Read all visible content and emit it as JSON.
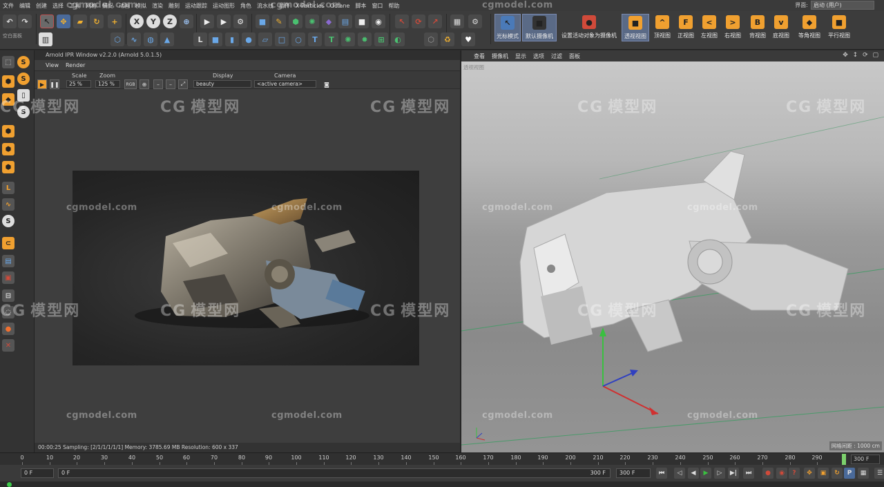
{
  "menubar": {
    "items": [
      "文件",
      "编辑",
      "创建",
      "选择",
      "工具",
      "网格",
      "捕捉",
      "动画",
      "模拟",
      "渲染",
      "雕刻",
      "运动跟踪",
      "运动图形",
      "角色",
      "流水线",
      "插件",
      "X-Particles",
      "Octane",
      "脚本",
      "窗口",
      "帮助"
    ],
    "layout_label": "界面:",
    "layout_value": "启动 (用户)"
  },
  "toolbar": {
    "left_top": "空白面板",
    "icons": [
      "undo-icon",
      "select-arrow-icon",
      "move-icon",
      "scale-icon",
      "rotate-icon",
      "x-axis-icon",
      "y-axis-icon",
      "z-axis-icon",
      "world-coords-icon",
      "render-view-icon",
      "render-picture-queue-icon",
      "render-settings-icon",
      "cube-icon",
      "pen-icon",
      "subdivision-icon",
      "cloner-icon",
      "deformer-icon",
      "floor-icon",
      "camera-icon",
      "light-icon"
    ],
    "axis_labels": {
      "x": "X",
      "y": "Y",
      "z": "Z"
    },
    "view_buttons": [
      {
        "label": "光标模式",
        "glyph": "↖",
        "color": "#4a7ab8",
        "selected": true
      },
      {
        "label": "默认摄像机",
        "glyph": "■",
        "color": "#333333",
        "selected": true
      },
      {
        "label": "设置活动对象为摄像机",
        "glyph": "●",
        "color": "#d04a3a",
        "selected": false
      },
      {
        "label": "透视视图",
        "glyph": "■",
        "color": "#f0a030",
        "selected": true
      },
      {
        "label": "顶视图",
        "glyph": "^",
        "color": "#f0a030",
        "selected": false
      },
      {
        "label": "正视图",
        "glyph": "F",
        "color": "#f0a030",
        "selected": false
      },
      {
        "label": "左视图",
        "glyph": "<",
        "color": "#f0a030",
        "selected": false
      },
      {
        "label": "右视图",
        "glyph": ">",
        "color": "#f0a030",
        "selected": false
      },
      {
        "label": "背视图",
        "glyph": "B",
        "color": "#f0a030",
        "selected": false
      },
      {
        "label": "底视图",
        "glyph": "v",
        "color": "#f0a030",
        "selected": false
      },
      {
        "label": "等角视图",
        "glyph": "◆",
        "color": "#f0a030",
        "selected": false
      },
      {
        "label": "平行视图",
        "glyph": "■",
        "color": "#f0a030",
        "selected": false
      }
    ]
  },
  "ipr": {
    "title": "Arnold IPR Window v2.2.0 (Arnold 5.0.1.5)",
    "menu": [
      "View",
      "Render"
    ],
    "scale_label": "Scale",
    "scale_value": "25 %",
    "zoom_label": "Zoom",
    "zoom_value": "125 %",
    "rgb_label": "RGB",
    "display_label": "Display",
    "display_value": "beauty",
    "camera_label": "Camera",
    "camera_value": "<active camera>",
    "status": "00:00:25  Sampling: [2/1/1/1/1/1]  Memory: 3785.69 MB  Resolution: 600 x 337"
  },
  "viewport": {
    "menu": [
      "查看",
      "摄像机",
      "显示",
      "选项",
      "过滤",
      "面板"
    ],
    "view_label": "透视视图",
    "nav_icons": "✥ ↕ ⟳ ▢",
    "grid_label": "网格间距 : 1000 cm"
  },
  "watermarks": {
    "url": "cgmodel.com",
    "logo": "模型网",
    "logo_prefix": "CG"
  },
  "timeline": {
    "ticks": [
      "0",
      "10",
      "20",
      "30",
      "40",
      "50",
      "60",
      "70",
      "80",
      "90",
      "100",
      "110",
      "120",
      "130",
      "140",
      "150",
      "160",
      "170",
      "180",
      "190",
      "200",
      "210",
      "220",
      "230",
      "240",
      "250",
      "260",
      "270",
      "280",
      "290"
    ],
    "end_frame": "300 F"
  },
  "transport": {
    "current_frame": "0 F",
    "range_start": "0 F",
    "range_end": "300 F",
    "max_frame": "300 F",
    "buttons": [
      "go-start-icon",
      "prev-key-icon",
      "prev-frame-icon",
      "play-icon",
      "next-frame-icon",
      "next-key-icon",
      "go-end-icon",
      "record-icon",
      "autokey-icon",
      "keyframe-icon",
      "move-key-icon",
      "scale-key-icon",
      "rotate-key-icon",
      "param-key-icon",
      "point-level-icon",
      "timeline-icon"
    ]
  }
}
